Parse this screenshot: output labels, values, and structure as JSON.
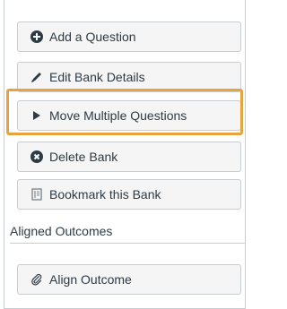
{
  "actions": [
    {
      "label": "Add a Question",
      "icon": "plus-circle-icon"
    },
    {
      "label": "Edit Bank Details",
      "icon": "pencil-icon"
    },
    {
      "label": "Move Multiple Questions",
      "icon": "play-triangle-icon"
    },
    {
      "label": "Delete Bank",
      "icon": "x-circle-icon"
    },
    {
      "label": "Bookmark this Bank",
      "icon": "bookmark-icon"
    }
  ],
  "outcomes": {
    "heading": "Aligned Outcomes",
    "align_label": "Align Outcome",
    "align_icon": "paperclip-icon"
  },
  "highlight_color": "#e8a33c"
}
